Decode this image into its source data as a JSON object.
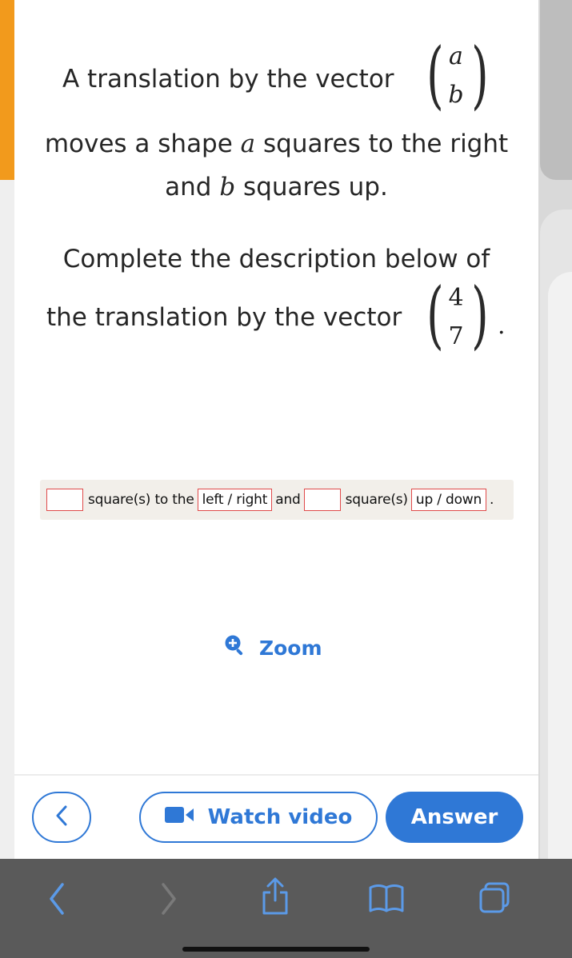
{
  "question": {
    "line1": "A translation by the vector",
    "vector_general": [
      "a",
      "b"
    ],
    "line2_pre": "moves a shape ",
    "line2_var": "a",
    "line2_post": " squares to the right",
    "line3_pre": "and ",
    "line3_var": "b",
    "line3_post": " squares up.",
    "line4": "Complete the description below of",
    "line5": "the translation by the vector",
    "vector_specific": [
      "4",
      "7"
    ],
    "line5_end": "."
  },
  "answer_row": {
    "text1": "square(s) to the",
    "choice1": "left / right",
    "text2": "and",
    "text3": "square(s)",
    "choice2": "up / down",
    "end": "."
  },
  "zoom": {
    "label": "Zoom",
    "icon": "zoom-in-icon"
  },
  "buttons": {
    "back_icon": "chevron-left-icon",
    "video_label": "Watch video",
    "video_icon": "video-camera-icon",
    "answer_label": "Answer"
  },
  "browser_toolbar": {
    "icons": [
      "back-arrow-icon",
      "forward-arrow-icon",
      "share-icon",
      "bookmarks-icon",
      "tabs-icon"
    ]
  },
  "colors": {
    "accent_blue": "#2f78d6",
    "blank_red": "#e04a4a",
    "toolbar_gray": "#5a5a5a",
    "left_accent_orange": "#f29a1c"
  }
}
